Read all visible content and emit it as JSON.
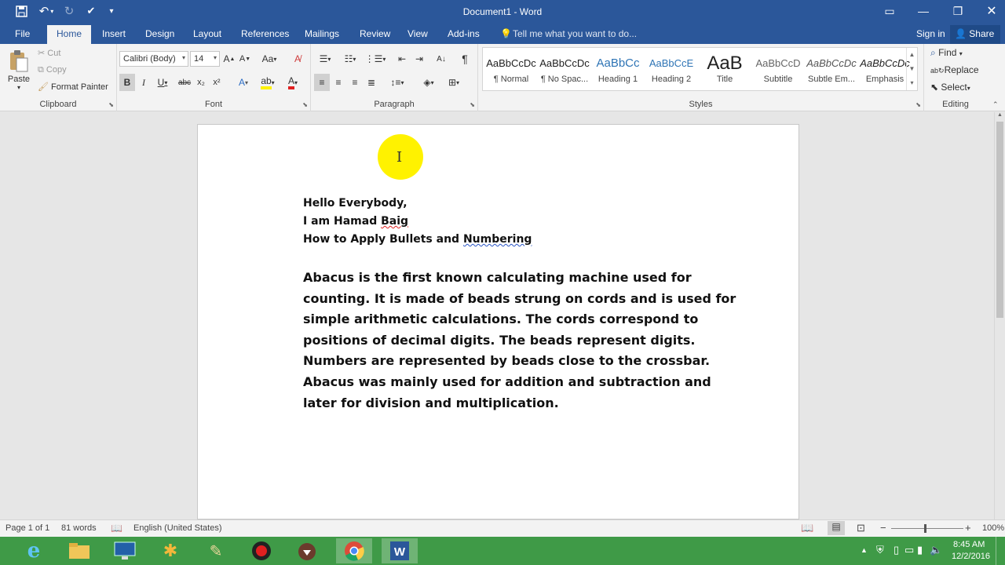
{
  "titlebar": {
    "title": "Document1 - Word"
  },
  "tabs": [
    {
      "label": "File"
    },
    {
      "label": "Home"
    },
    {
      "label": "Insert"
    },
    {
      "label": "Design"
    },
    {
      "label": "Layout"
    },
    {
      "label": "References"
    },
    {
      "label": "Mailings"
    },
    {
      "label": "Review"
    },
    {
      "label": "View"
    },
    {
      "label": "Add-ins"
    }
  ],
  "tell_me": {
    "placeholder": "Tell me what you want to do..."
  },
  "account": {
    "signin": "Sign in",
    "share": "Share"
  },
  "clipboard": {
    "label": "Clipboard",
    "paste": "Paste",
    "cut": "Cut",
    "copy": "Copy",
    "format_painter": "Format Painter"
  },
  "font": {
    "label": "Font",
    "name": "Calibri (Body)",
    "size": "14"
  },
  "paragraph": {
    "label": "Paragraph"
  },
  "styles": {
    "label": "Styles",
    "items": [
      {
        "preview": "AaBbCcDc",
        "name": "¶ Normal"
      },
      {
        "preview": "AaBbCcDc",
        "name": "¶ No Spac..."
      },
      {
        "preview": "AaBbCc",
        "name": "Heading 1"
      },
      {
        "preview": "AaBbCcE",
        "name": "Heading 2"
      },
      {
        "preview": "AaB",
        "name": "Title"
      },
      {
        "preview": "AaBbCcD",
        "name": "Subtitle"
      },
      {
        "preview": "AaBbCcDc",
        "name": "Subtle Em..."
      },
      {
        "preview": "AaBbCcDc",
        "name": "Emphasis"
      }
    ]
  },
  "editing": {
    "label": "Editing",
    "find": "Find",
    "replace": "Replace",
    "select": "Select"
  },
  "document": {
    "line1": "Hello Everybody,",
    "line2a": "I am Hamad ",
    "line2b": "Baig",
    "line3a": "How to Apply Bullets and ",
    "line3b": "Numbering",
    "body": "Abacus is the first known calculating machine used for counting. It is made of beads strung on cords and is used for simple arithmetic calculations. The cords correspond to positions of decimal digits. The beads represent digits. Numbers are represented by beads close to the crossbar. Abacus was mainly used for addition and subtraction and later for division and multiplication."
  },
  "status": {
    "page": "Page 1 of 1",
    "words": "81 words",
    "language": "English (United States)",
    "zoom": "100%"
  },
  "clock": {
    "time": "8:45 AM",
    "date": "12/2/2016"
  },
  "colors": {
    "accent": "#2b579a",
    "taskbar": "#3f9a47",
    "highlight": "#fff200"
  }
}
